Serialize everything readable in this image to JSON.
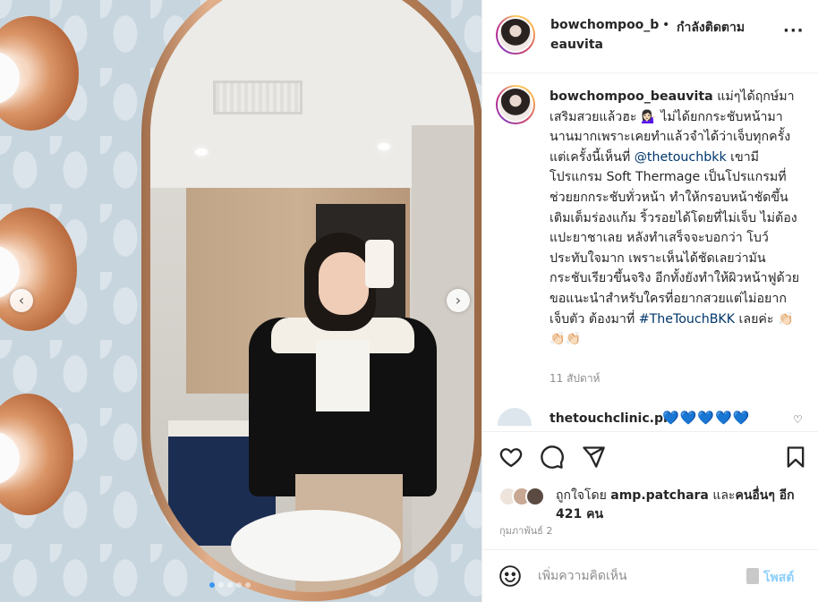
{
  "post": {
    "carousel": {
      "prev_label": "‹",
      "next_label": "›",
      "slide_count": 5,
      "active_slide": 0
    },
    "header": {
      "username": "bowchompoo_b",
      "username_cont": "eauvita",
      "separator": "•",
      "follow_status": "กำลังติดตาม",
      "more_label": "···"
    },
    "caption": {
      "username": "bowchompoo_beauvita",
      "text_1": " แม่ๆได้ฤกษ์มาเสริมสวยแล้วฮะ 💁🏻‍♀️ ไม่ได้ยกกระชับหน้ามานานมากเพราะเคยทำแล้วจำได้ว่าเจ็บทุกครั้ง แต่เครั้งนี้เห็นที่ ",
      "mention": "@thetouchbkk",
      "text_2": " เขามีโปรแกรม Soft Thermage เป็นโปรแกรมที่ช่วยยกกระชับทั่วหน้า ทำให้กรอบหน้าชัดขึ้น เติมเต็มร่องแก้ม ริ้วรอยได้โดยที่ไม่เจ็บ ไม่ต้องแปะยาชาเลย หลังทำเสร็จจะบอกว่า โบว์ประทับใจมาก เพราะเห็นได้ชัดเลยว่ามันกระชับเรียวขึ้นจริง อีกทั้งยังทำให้ผิวหน้าฟูด้วย ขอแนะนำสำหรับใครที่อยากสวยแต่ไม่อยากเจ็บตัว ต้องมาที่ ",
      "hashtag": "#TheTouchBKK",
      "text_3": " เลยค่ะ 👏🏻👏🏻👏🏻",
      "time_ago": "11 สัปดาห์"
    },
    "comment": {
      "username": "thetouchclinic.pk",
      "text": "💙💙💙💙💙"
    },
    "likes": {
      "prefix": "ถูกใจโดย ",
      "first_user": "amp.patchara",
      "middle": " และ",
      "others_bold": "คนอื่นๆ อีก 421 คน"
    },
    "date": "กุมภาพันธ์ 2",
    "add_comment": {
      "placeholder": "เพิ่มความคิดเห็น",
      "post_label": "โพสต์"
    },
    "colors": {
      "link": "#00376b",
      "post_button": "#0095f6",
      "secondary_text": "#8e8e8e",
      "border": "#efefef"
    }
  }
}
